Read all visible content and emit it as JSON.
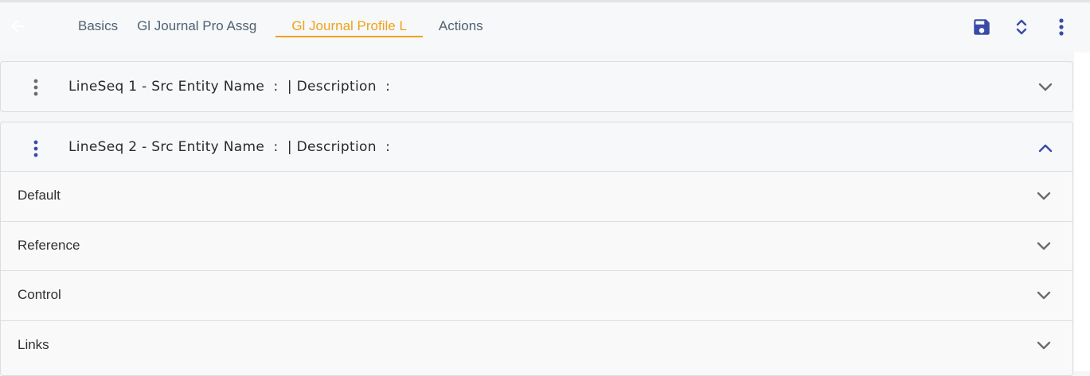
{
  "tabs": [
    {
      "label": "Basics"
    },
    {
      "label": "Gl Journal Pro Assg"
    },
    {
      "label": "Gl Journal Profile L"
    },
    {
      "label": "Actions"
    }
  ],
  "active_tab_index": 2,
  "toolbar": {
    "back_icon": "arrow-left-icon",
    "save_icon": "save-icon",
    "expand_collapse_icon": "expand-collapse-icon",
    "more_icon": "more-vert-icon"
  },
  "lines": [
    {
      "title": "LineSeq 1 - Src Entity Name  :  | Description  :",
      "expanded": false
    },
    {
      "title": "LineSeq 2 - Src Entity Name  :  | Description  :",
      "expanded": true
    }
  ],
  "sections": [
    {
      "label": "Default"
    },
    {
      "label": "Reference"
    },
    {
      "label": "Control"
    },
    {
      "label": "Links"
    }
  ],
  "colors": {
    "accent_orange": "#f0a21a",
    "primary_blue": "#3b4aa6",
    "muted_gray": "#6b6b6b"
  }
}
